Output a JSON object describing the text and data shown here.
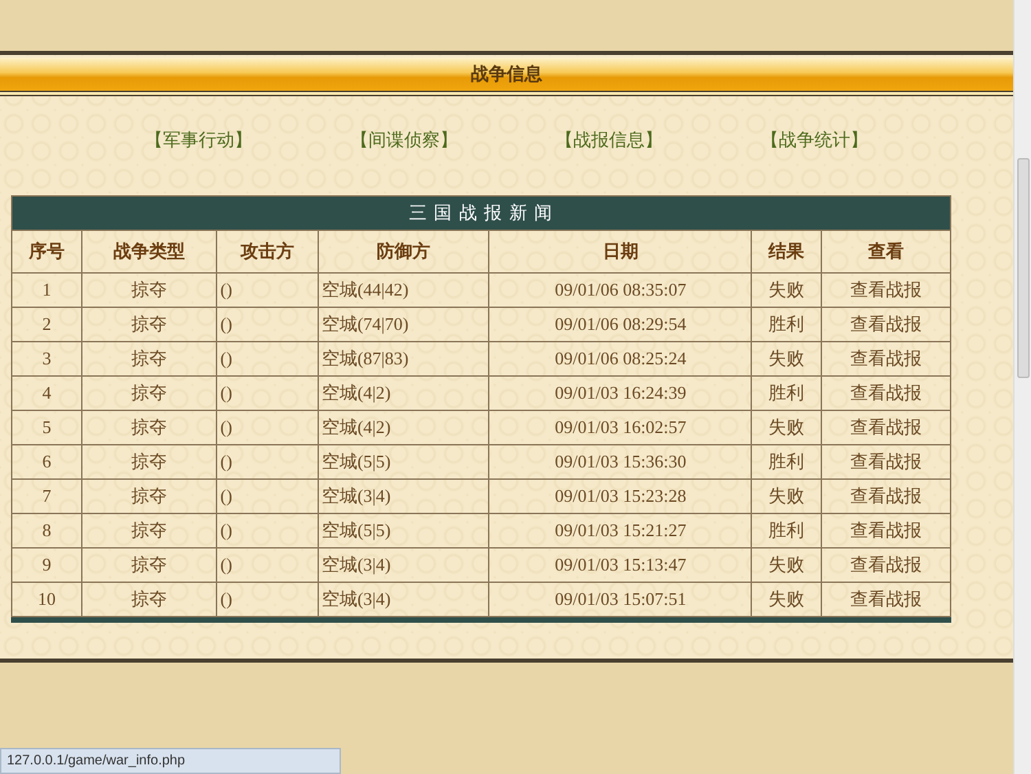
{
  "banner": {
    "title": "战争信息"
  },
  "nav_links": [
    {
      "label": "【军事行动】"
    },
    {
      "label": "【间谍侦察】"
    },
    {
      "label": "【战报信息】"
    },
    {
      "label": "【战争统计】"
    }
  ],
  "table": {
    "title": "三 国 战 报 新 闻",
    "columns": [
      "序号",
      "战争类型",
      "攻击方",
      "防御方",
      "日期",
      "结果",
      "查看"
    ],
    "rows": [
      [
        "1",
        "掠夺",
        "()",
        "空城(44|42)",
        "09/01/06 08:35:07",
        "失败",
        "查看战报"
      ],
      [
        "2",
        "掠夺",
        "()",
        "空城(74|70)",
        "09/01/06 08:29:54",
        "胜利",
        "查看战报"
      ],
      [
        "3",
        "掠夺",
        "()",
        "空城(87|83)",
        "09/01/06 08:25:24",
        "失败",
        "查看战报"
      ],
      [
        "4",
        "掠夺",
        "()",
        "空城(4|2)",
        "09/01/03 16:24:39",
        "胜利",
        "查看战报"
      ],
      [
        "5",
        "掠夺",
        "()",
        "空城(4|2)",
        "09/01/03 16:02:57",
        "失败",
        "查看战报"
      ],
      [
        "6",
        "掠夺",
        "()",
        "空城(5|5)",
        "09/01/03 15:36:30",
        "胜利",
        "查看战报"
      ],
      [
        "7",
        "掠夺",
        "()",
        "空城(3|4)",
        "09/01/03 15:23:28",
        "失败",
        "查看战报"
      ],
      [
        "8",
        "掠夺",
        "()",
        "空城(5|5)",
        "09/01/03 15:21:27",
        "胜利",
        "查看战报"
      ],
      [
        "9",
        "掠夺",
        "()",
        "空城(3|4)",
        "09/01/03 15:13:47",
        "失败",
        "查看战报"
      ],
      [
        "10",
        "掠夺",
        "()",
        "空城(3|4)",
        "09/01/03 15:07:51",
        "失败",
        "查看战报"
      ]
    ]
  },
  "status_bar": {
    "url": "127.0.0.1/game/war_info.php"
  }
}
